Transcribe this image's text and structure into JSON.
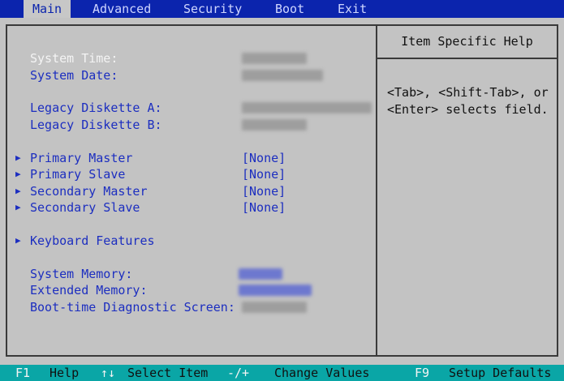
{
  "menu": {
    "tabs": [
      "Main",
      "Advanced",
      "Security",
      "Boot",
      "Exit"
    ],
    "active": "Main"
  },
  "help": {
    "title": "Item Specific Help",
    "text": "<Tab>, <Shift-Tab>, or\n<Enter> selects field."
  },
  "main": {
    "system_time": "System Time:",
    "system_date": "System Date:",
    "legacy_a": "Legacy Diskette A:",
    "legacy_b": "Legacy Diskette B:",
    "primary_master": "Primary Master",
    "primary_slave": "Primary Slave",
    "secondary_master": "Secondary Master",
    "secondary_slave": "Secondary Slave",
    "primary_master_value": "[None]",
    "primary_slave_value": "[None]",
    "secondary_master_value": "[None]",
    "secondary_slave_value": "[None]",
    "keyboard_features": "Keyboard Features",
    "system_memory": "System Memory:",
    "extended_memory": "Extended Memory:",
    "boot_diag": "Boot-time Diagnostic Screen:"
  },
  "footer": {
    "f1_key": "F1",
    "f1_action": "Help",
    "select_key": "↑↓",
    "select_action": "Select Item",
    "change_key": "-/+",
    "change_action": "Change Values",
    "f9_key": "F9",
    "f9_action": "Setup Defaults"
  },
  "colors": {
    "menubar_bg": "#0b24ad",
    "panel_bg": "#c3c3c3",
    "footer_bg": "#0aa6a6",
    "label_blue": "#1c2ec0"
  }
}
